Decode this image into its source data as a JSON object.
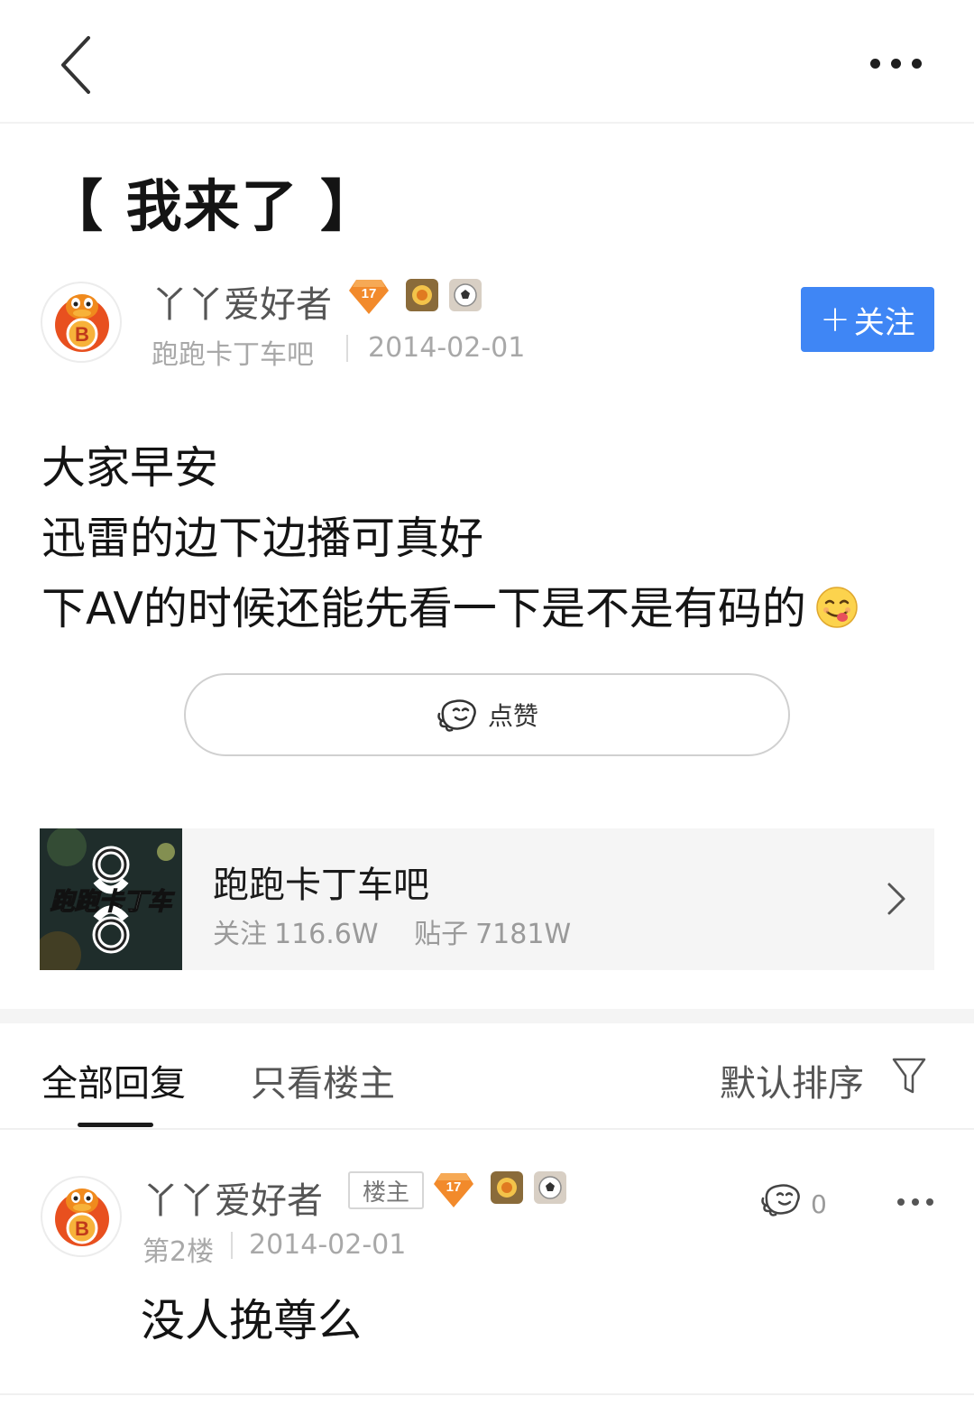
{
  "header": {
    "back_icon": "chevron-left-icon",
    "more_icon": "ellipsis-icon"
  },
  "post": {
    "title": "【 我来了 】",
    "author": {
      "name": "丫丫爱好者",
      "level": "17",
      "avatar_icon": "duck-b-avatar-icon"
    },
    "forum": "跑跑卡丁车吧",
    "date": "2014-02-01",
    "follow_label": "关注",
    "body_lines": [
      "大家早安",
      "迅雷的边下边播可真好",
      "下AV的时候还能先看一下是不是有码的"
    ],
    "emoji": "tongue-out-emoji",
    "like_label": "点赞"
  },
  "forum_card": {
    "name": "跑跑卡丁车吧",
    "logo_text": "跑跑卡丁车",
    "followers_label": "关注",
    "followers_value": "116.6W",
    "posts_label": "贴子",
    "posts_value": "7181W"
  },
  "tabs": {
    "all_replies": "全部回复",
    "owner_only": "只看楼主",
    "sort": "默认排序"
  },
  "reply": {
    "author": "丫丫爱好者",
    "owner_tag": "楼主",
    "level": "17",
    "floor": "第2楼",
    "date": "2014-02-01",
    "like_count": "0",
    "text": "没人挽尊么"
  },
  "colors": {
    "accent": "#3f86f5",
    "level_badge": "#f28a2b",
    "text": "#141414",
    "muted": "#a8a8a8"
  }
}
